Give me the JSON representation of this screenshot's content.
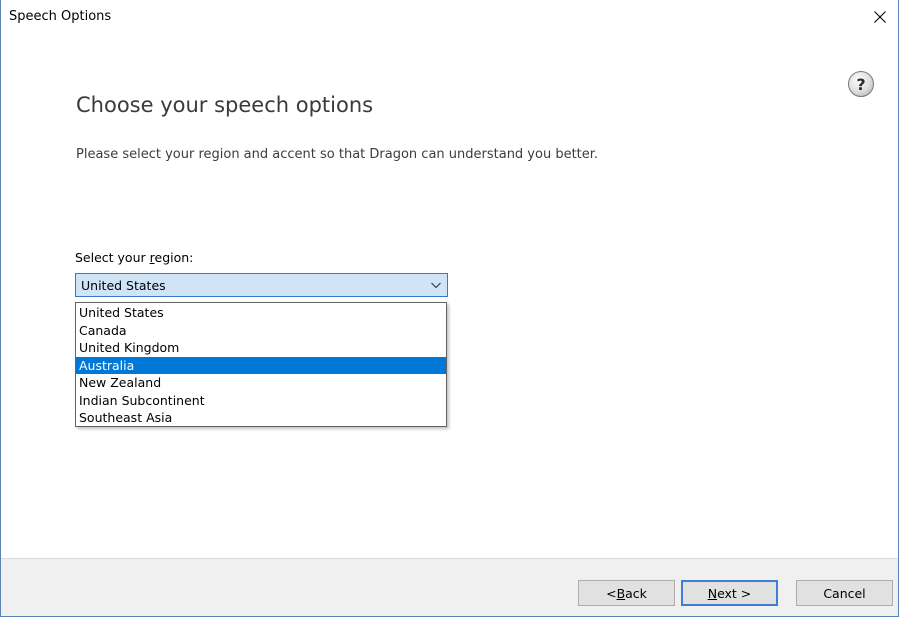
{
  "window": {
    "title": "Speech Options"
  },
  "icons": {
    "close": "close-icon",
    "help": "help-icon",
    "help_glyph": "?",
    "chevron": "chevron-down-icon"
  },
  "main": {
    "heading": "Choose your speech options",
    "subtext": "Please select your region and accent so that Dragon can understand you better."
  },
  "region": {
    "label_prefix": "Select your ",
    "label_mnemonic": "r",
    "label_suffix": "egion:",
    "selected_value": "United States",
    "options": [
      "United States",
      "Canada",
      "United Kingdom",
      "Australia",
      "New Zealand",
      "Indian Subcontinent",
      "Southeast Asia"
    ],
    "highlighted_option": "Australia"
  },
  "footer": {
    "back_prefix": "< ",
    "back_mnemonic": "B",
    "back_suffix": "ack",
    "next_mnemonic": "N",
    "next_suffix": "ext >",
    "cancel_label": "Cancel"
  },
  "colors": {
    "accent": "#0078d7",
    "combo_bg": "#cfe4f7",
    "footer_bg": "#f0f0f0"
  }
}
